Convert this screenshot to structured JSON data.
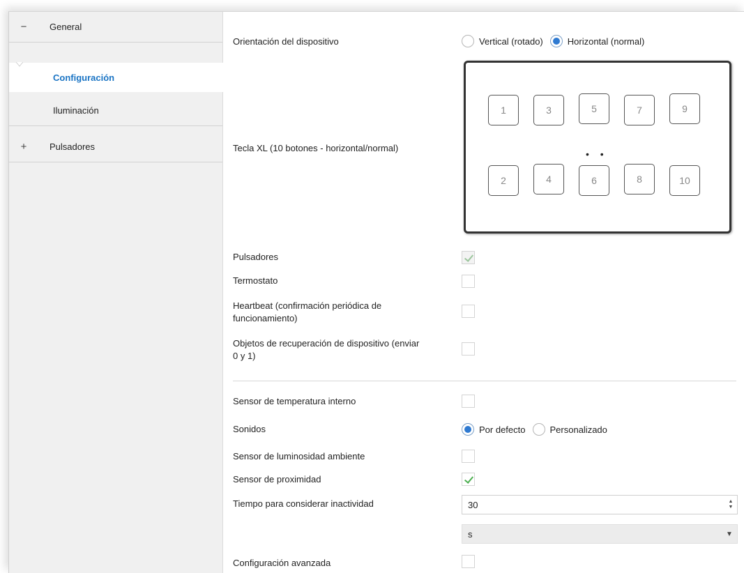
{
  "sidebar": {
    "general": {
      "sign": "−",
      "label": "General"
    },
    "configuracion": {
      "label": "Configuración"
    },
    "iluminacion": {
      "label": "Iluminación"
    },
    "pulsadores": {
      "sign": "+",
      "label": "Pulsadores"
    }
  },
  "main": {
    "orientation": {
      "label": "Orientación del dispositivo",
      "options": [
        "Vertical (rotado)",
        "Horizontal (normal)"
      ],
      "selected": "Horizontal (normal)"
    },
    "model": {
      "label": "Tecla XL (10 botones - horizontal/normal)",
      "keys_top": [
        "1",
        "3",
        "5",
        "7",
        "9"
      ],
      "keys_bottom": [
        "2",
        "4",
        "6",
        "8",
        "10"
      ],
      "dots": "• •"
    },
    "pulsadores": {
      "label": "Pulsadores",
      "checked": true,
      "disabled": true
    },
    "termostato": {
      "label": "Termostato",
      "checked": false
    },
    "heartbeat": {
      "label_line1": "Heartbeat (confirmación periódica de",
      "label_line2": "funcionamiento)",
      "checked": false
    },
    "recuperacion": {
      "label_line1": "Objetos de recuperación de dispositivo (enviar",
      "label_line2": "0 y 1)",
      "checked": false
    },
    "sensor_temp": {
      "label": "Sensor de temperatura interno",
      "checked": false
    },
    "sonidos": {
      "label": "Sonidos",
      "options": [
        "Por defecto",
        "Personalizado"
      ],
      "selected": "Por defecto"
    },
    "luminosidad": {
      "label": "Sensor de luminosidad ambiente",
      "checked": false
    },
    "proximidad": {
      "label": "Sensor de proximidad",
      "checked": true
    },
    "inactividad": {
      "label": "Tiempo para considerar inactividad",
      "value": "30",
      "unit": "s"
    },
    "avanzada": {
      "label": "Configuración avanzada",
      "checked": false
    }
  },
  "colors": {
    "accent": "#1a74c4",
    "check": "#4caf50",
    "radio": "#2f7ad1"
  }
}
